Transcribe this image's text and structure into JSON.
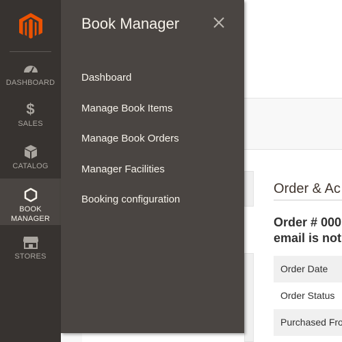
{
  "sidebar": {
    "logo": "magento-logo",
    "items": [
      {
        "label": "DASHBOARD",
        "icon": "dashboard-icon"
      },
      {
        "label": "SALES",
        "icon": "dollar-icon",
        "glyph": "$"
      },
      {
        "label": "CATALOG",
        "icon": "box-icon"
      },
      {
        "label": "BOOK MANAGER",
        "icon": "hexagon-icon"
      },
      {
        "label": "STORES",
        "icon": "store-icon"
      }
    ]
  },
  "flyout": {
    "title": "Book Manager",
    "menu": [
      {
        "label": "Dashboard"
      },
      {
        "label": "Manage Book Items"
      },
      {
        "label": "Manage Book Orders"
      },
      {
        "label": "Manager Facilities"
      },
      {
        "label": "Booking configuration"
      }
    ]
  },
  "content": {
    "section_title": "Order & Ac",
    "order_heading_line1": "Order # 000",
    "order_heading_line2": "email is not",
    "rows": [
      {
        "label": "Order Date"
      },
      {
        "label": "Order Status"
      },
      {
        "label": "Purchased Fro"
      }
    ]
  },
  "colors": {
    "brand_orange": "#eb5202",
    "sidebar_bg": "#373330",
    "flyout_bg": "#4a4542",
    "text_light": "#f7f3eb"
  }
}
